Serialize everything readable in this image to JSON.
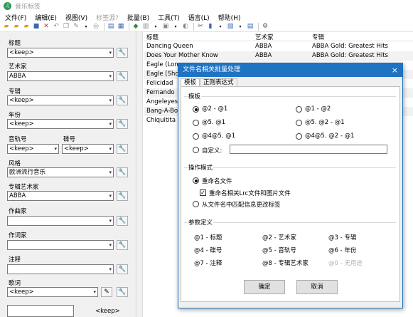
{
  "app": {
    "title": "音乐标签"
  },
  "menu": [
    "文件(F)",
    "编辑(E)",
    "视图(V)",
    "标签源?",
    "批量(B)",
    "工具(T)",
    "语言(L)",
    "帮助(H)"
  ],
  "menu_disabled_index": 3,
  "toolbar": {
    "icons": [
      "folder-open-icon",
      "folder-add-icon",
      "folder-icon",
      "save-icon",
      "delete-icon",
      "undo-icon",
      "copy-icon",
      "tag-icon",
      "dropdown-icon",
      "zoom-icon",
      "sep",
      "panel-left-icon",
      "panel-grid-icon",
      "sep",
      "refresh-icon",
      "list-icon",
      "dropdown-icon",
      "convert-icon",
      "dropdown-icon",
      "sep",
      "tools-icon",
      "file-icon",
      "dropdown-icon",
      "image-icon",
      "dropdown-icon",
      "export-icon",
      "sep",
      "settings-icon"
    ]
  },
  "left_panel": {
    "fields": [
      {
        "label": "标题",
        "value": "<keep>"
      },
      {
        "label": "艺术家",
        "value": "ABBA"
      },
      {
        "label": "专辑",
        "value": "<keep>"
      },
      {
        "label": "年份",
        "value": "<keep>"
      },
      {
        "label": "风格",
        "value": "欧洲流行音乐"
      },
      {
        "label": "专辑艺术家",
        "value": "ABBA"
      },
      {
        "label": "作曲家",
        "value": ""
      },
      {
        "label": "作词家",
        "value": ""
      },
      {
        "label": "注释",
        "value": ""
      },
      {
        "label": "歌词",
        "value": "<keep>"
      }
    ],
    "track": {
      "label": "音轨号",
      "value": "<keep>"
    },
    "disc": {
      "label": "碟号",
      "value": "<keep>"
    },
    "cover_value": "<keep>"
  },
  "grid": {
    "columns": [
      "标题",
      "艺术家",
      "专辑"
    ],
    "rows": [
      [
        "Dancing Queen",
        "ABBA",
        "ABBA Gold: Greatest Hits"
      ],
      [
        "Does Your Mother Know",
        "ABBA",
        "ABBA Gold: Greatest Hits"
      ],
      [
        "Eagle (Long V",
        "",
        ""
      ],
      [
        "Eagle [Short V",
        "",
        ""
      ],
      [
        "Felicidad",
        "",
        ""
      ],
      [
        "Fernando",
        "",
        ""
      ],
      [
        "Angeleyes",
        "",
        ""
      ],
      [
        "Bang-A-Boom",
        "",
        ""
      ],
      [
        "Chiquitita",
        "",
        ""
      ]
    ]
  },
  "dialog": {
    "title": "文件名相关批量处理",
    "close": "×",
    "tabs": [
      "模板",
      "正则表达式"
    ],
    "template_group": "模板",
    "template_options": [
      "@2 - @1",
      "@1 - @2",
      "@5. @1",
      "@5. @2 - @1",
      "@4@5. @1",
      "@4@5. @2 - @1"
    ],
    "template_selected": 0,
    "custom_label": "自定义:",
    "custom_value": "",
    "mode_group": "操作模式",
    "mode_rename": "重命名文件",
    "mode_rename_lrc": "重命名相关Lrc文件和图片文件",
    "mode_rename_lrc_checked": true,
    "mode_tag": "从文件名中匹配信息更改标签",
    "param_group": "参数定义",
    "params": [
      "@1 - 标题",
      "@2 - 艺术家",
      "@3 - 专辑",
      "@4 - 碟号",
      "@5 - 音轨号",
      "@6 - 年份",
      "@7 - 注释",
      "@8 - 专辑艺术家",
      "@0 - 无用途"
    ],
    "ok": "确定",
    "cancel": "取消"
  }
}
